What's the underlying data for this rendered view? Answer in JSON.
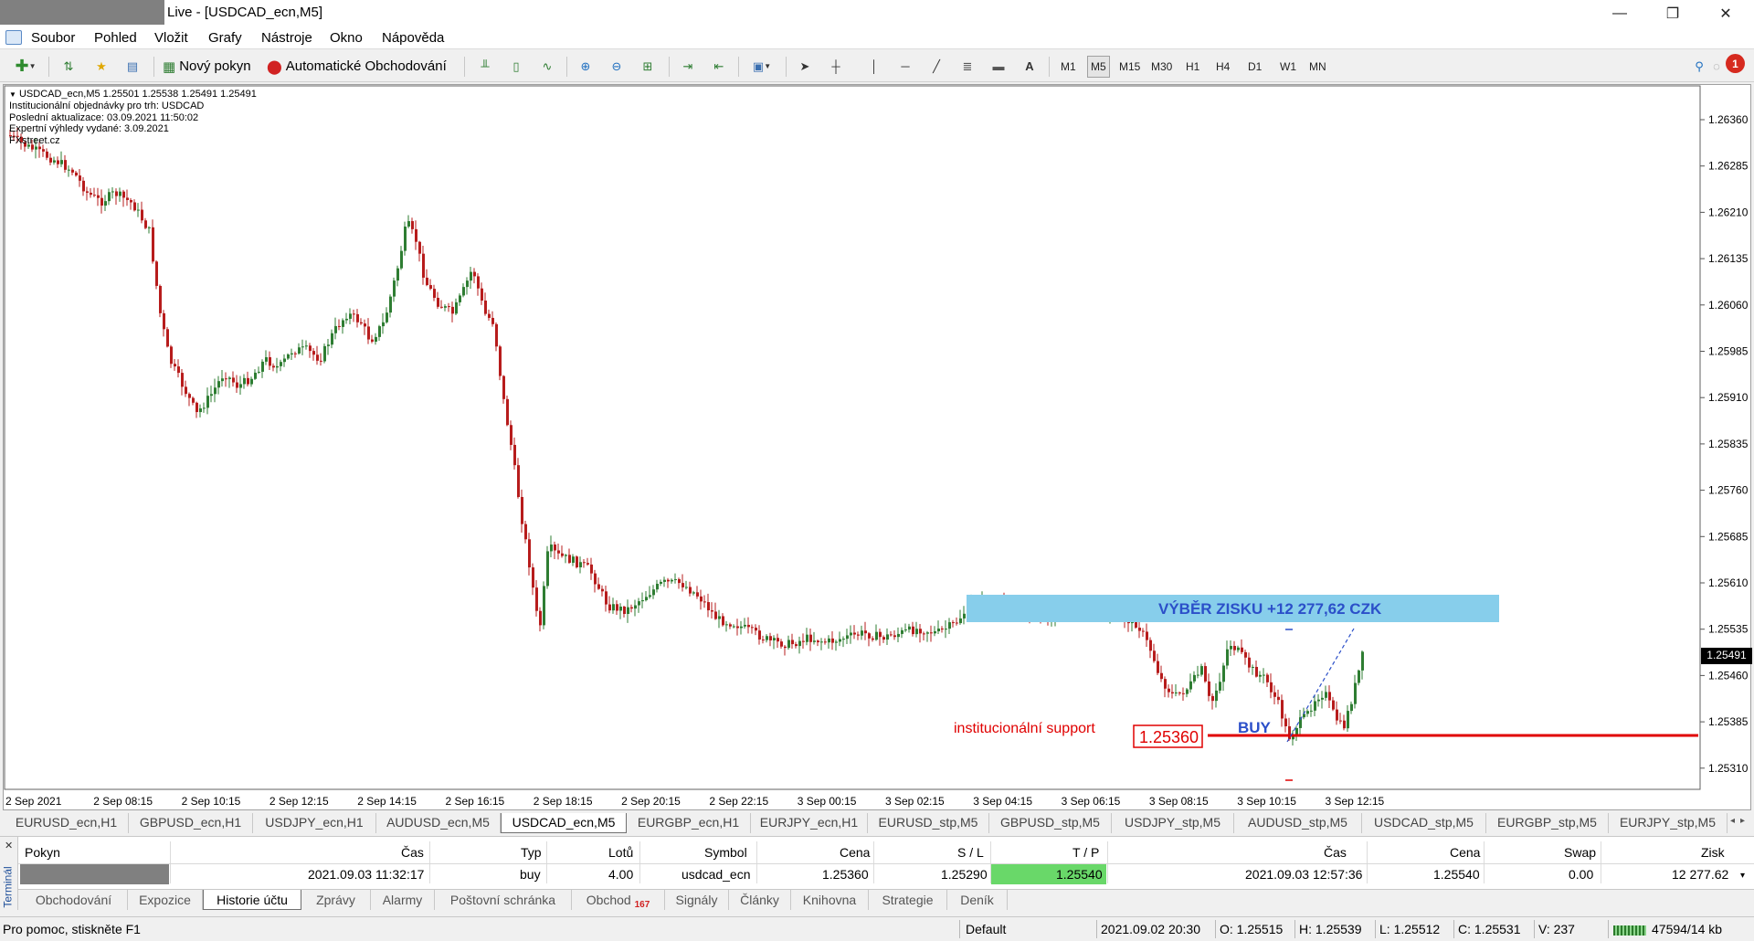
{
  "window": {
    "title": "Live - [USDCAD_ecn,M5]",
    "controls": [
      "—",
      "❐",
      "✕"
    ]
  },
  "menu": [
    "Soubor",
    "Pohled",
    "Vložit",
    "Grafy",
    "Nástroje",
    "Okno",
    "Nápověda"
  ],
  "toolbar": {
    "new_order_label": "Nový pokyn",
    "auto_trading_label": "Automatické Obchodování",
    "timeframes": [
      "M1",
      "M5",
      "M15",
      "M30",
      "H1",
      "H4",
      "D1",
      "W1",
      "MN"
    ],
    "active_timeframe": "M5",
    "text_tool_label": "A",
    "notification_count": "1"
  },
  "chart": {
    "header_line": "USDCAD_ecn,M5  1.25501 1.25538 1.25491 1.25491",
    "info_lines": [
      "Institucionální objednávky pro trh: USDCAD",
      "Poslední aktualizace: 03.09.2021 11:50:02",
      "Expertní výhledy vydané: 3.09.2021",
      "FXstreet.cz"
    ],
    "price_axis": [
      "1.26360",
      "1.26285",
      "1.26210",
      "1.26135",
      "1.26060",
      "1.25985",
      "1.25910",
      "1.25835",
      "1.25760",
      "1.25685",
      "1.25610",
      "1.25535",
      "1.25460",
      "1.25385",
      "1.25310"
    ],
    "current_price": "1.25491",
    "time_axis": [
      "2 Sep 2021",
      "2 Sep 08:15",
      "2 Sep 10:15",
      "2 Sep 12:15",
      "2 Sep 14:15",
      "2 Sep 16:15",
      "2 Sep 18:15",
      "2 Sep 20:15",
      "2 Sep 22:15",
      "3 Sep 00:15",
      "3 Sep 02:15",
      "3 Sep 04:15",
      "3 Sep 06:15",
      "3 Sep 08:15",
      "3 Sep 10:15",
      "3 Sep 12:15"
    ],
    "profit_banner": "VÝBĚR ZISKU +12 277,62 CZK",
    "support_label": "institucionální support",
    "support_price": "1.25360",
    "buy_label": "BUY",
    "colors": {
      "bull": "#2e7d32",
      "bear": "#b71c1c",
      "support_line": "#e00000",
      "banner_bg": "#87ceeb",
      "banner_text": "#2b4fc9"
    }
  },
  "symbol_tabs": [
    "EURUSD_ecn,H1",
    "GBPUSD_ecn,H1",
    "USDJPY_ecn,H1",
    "AUDUSD_ecn,M5",
    "USDCAD_ecn,M5",
    "EURGBP_ecn,H1",
    "EURJPY_ecn,H1",
    "EURUSD_stp,M5",
    "GBPUSD_stp,M5",
    "USDJPY_stp,M5",
    "AUDUSD_stp,M5",
    "USDCAD_stp,M5",
    "EURGBP_stp,M5",
    "EURJPY_stp,M5"
  ],
  "active_symbol_tab": "USDCAD_ecn,M5",
  "terminal": {
    "side_label": "Terminál",
    "headers": [
      "Pokyn",
      "Čas",
      "Typ",
      "Lotů",
      "Symbol",
      "Cena",
      "S / L",
      "T / P",
      "Čas",
      "Cena",
      "Swap",
      "Zisk"
    ],
    "row": {
      "open_time": "2021.09.03 11:32:17",
      "type": "buy",
      "lots": "4.00",
      "symbol": "usdcad_ecn",
      "open_price": "1.25360",
      "sl": "1.25290",
      "tp": "1.25540",
      "close_time": "2021.09.03 12:57:36",
      "close_price": "1.25540",
      "swap": "0.00",
      "profit": "12 277.62"
    },
    "tabs": [
      "Obchodování",
      "Expozice",
      "Historie účtu",
      "Zprávy",
      "Alarmy",
      "Poštovní schránka",
      "Obchod",
      "Signály",
      "Články",
      "Knihovna",
      "Strategie",
      "Deník"
    ],
    "trade_badge": "167",
    "active_tab": "Historie účtu"
  },
  "status": {
    "help": "Pro pomoc, stiskněte F1",
    "profile": "Default",
    "datetime": "2021.09.02 20:30",
    "open": "O: 1.25515",
    "high": "H: 1.25539",
    "low": "L: 1.25512",
    "close": "C: 1.25531",
    "volume": "V: 237",
    "traffic": "47594/14 kb"
  }
}
